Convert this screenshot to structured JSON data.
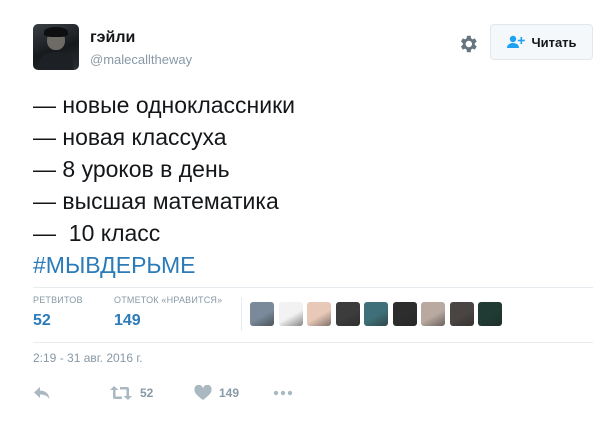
{
  "author": {
    "name": "гэйли",
    "handle": "@malecalltheway"
  },
  "actions_top": {
    "follow_label": "Читать",
    "settings_icon": "gear-icon",
    "follow_icon": "add-user-icon"
  },
  "tweet": {
    "lines": [
      "— новые одноклассники",
      "— новая классуха",
      "— 8 уроков в день",
      "— высшая математика",
      "—  10 класс"
    ],
    "hashtag": "#МЫВДЕРЬМЕ"
  },
  "stats": {
    "retweets_label": "РЕТВИТОВ",
    "retweets_count": "52",
    "likes_label": "ОТМЕТОК «НРАВИТСЯ»",
    "likes_count": "149"
  },
  "likers": [
    {
      "name": "liker-avatar-1",
      "color": "#7a8a9a"
    },
    {
      "name": "liker-avatar-2",
      "color": "#f2f2f2"
    },
    {
      "name": "liker-avatar-3",
      "color": "#e8c9b8"
    },
    {
      "name": "liker-avatar-4",
      "color": "#3c3c3c"
    },
    {
      "name": "liker-avatar-5",
      "color": "#3f6f78"
    },
    {
      "name": "liker-avatar-6",
      "color": "#2d2d2d"
    },
    {
      "name": "liker-avatar-7",
      "color": "#b9a9a0"
    },
    {
      "name": "liker-avatar-8",
      "color": "#4a4442"
    },
    {
      "name": "liker-avatar-9",
      "color": "#1f3b33"
    }
  ],
  "timestamp": "2:19 - 31 авг. 2016 г.",
  "footer": {
    "retweet_count": "52",
    "like_count": "149",
    "reply_icon": "reply-icon",
    "retweet_icon": "retweet-icon",
    "like_icon": "heart-icon",
    "more_icon": "more-icon"
  },
  "colors": {
    "link": "#2b7bb9",
    "muted": "#8899a6",
    "text": "#14171a"
  }
}
